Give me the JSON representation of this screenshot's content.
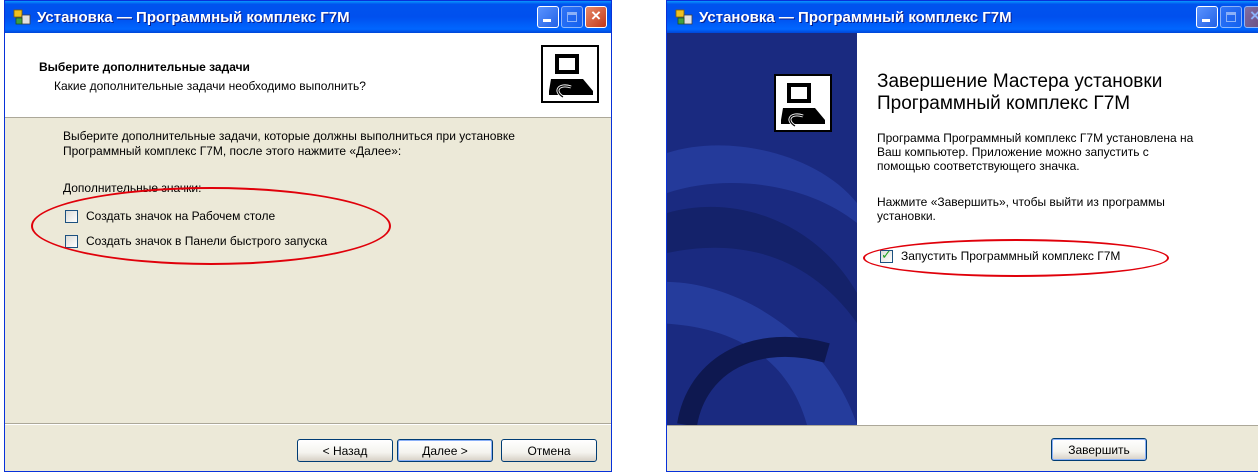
{
  "colors": {
    "title_bar": "#0054e3",
    "window_bg": "#ece9d8",
    "side_panel": "#1c2d86",
    "highlight_oval": "#e0000a"
  },
  "window1": {
    "title": "Установка — Программный комплекс Г7М",
    "header_title": "Выберите дополнительные задачи",
    "header_subtitle": "Какие дополнительные задачи необходимо выполнить?",
    "description_line1": "Выберите дополнительные задачи, которые должны выполниться при установке",
    "description_line2": "Программный комплекс Г7М, после этого нажмите «Далее»:",
    "group_label": "Дополнительные значки:",
    "tasks": [
      {
        "label": "Создать значок на Рабочем столе",
        "checked": false
      },
      {
        "label": "Создать значок в Панели быстрого запуска",
        "checked": false
      }
    ],
    "buttons": {
      "back": "< Назад",
      "next": "Далее >",
      "cancel": "Отмена"
    }
  },
  "window2": {
    "title": "Установка — Программный комплекс Г7М",
    "heading_line1": "Завершение Мастера установки",
    "heading_line2": "Программный комплекс Г7М",
    "info_line1": "Программа Программный комплекс Г7М установлена на",
    "info_line2": "Ваш компьютер. Приложение можно запустить с",
    "info_line3": "помощью соответствующего значка.",
    "finish_line1": "Нажмите «Завершить», чтобы выйти из программы",
    "finish_line2": "установки.",
    "launch_option": {
      "label": "Запустить Программный комплекс Г7М",
      "checked": true
    },
    "buttons": {
      "finish": "Завершить"
    }
  }
}
